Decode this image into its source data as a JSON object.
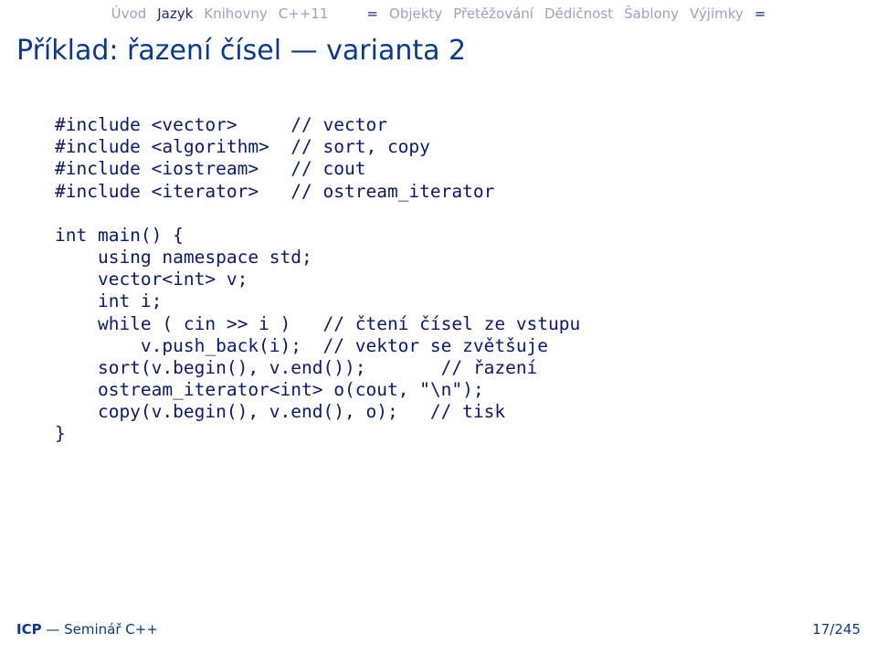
{
  "nav": {
    "items": [
      {
        "label": "Úvod",
        "active": false
      },
      {
        "label": "Jazyk",
        "active": true
      },
      {
        "label": "Knihovny",
        "active": false
      },
      {
        "label": "C++11",
        "active": false
      }
    ],
    "sep1": "=",
    "items2": [
      {
        "label": "Objekty",
        "active": false
      },
      {
        "label": "Přetěžování",
        "active": false
      },
      {
        "label": "Dědičnost",
        "active": false
      },
      {
        "label": "Šablony",
        "active": false
      },
      {
        "label": "Výjimky",
        "active": false
      }
    ],
    "sep2": "="
  },
  "title": "Příklad: řazení čísel — varianta 2",
  "code": "#include <vector>     // vector\n#include <algorithm>  // sort, copy\n#include <iostream>   // cout\n#include <iterator>   // ostream_iterator\n\nint main() {\n    using namespace std;\n    vector<int> v;\n    int i;\n    while ( cin >> i )   // čtení čísel ze vstupu\n        v.push_back(i);  // vektor se zvětšuje\n    sort(v.begin(), v.end());       // řazení\n    ostream_iterator<int> o(cout, \"\\n\");\n    copy(v.begin(), v.end(), o);   // tisk\n}",
  "footer": {
    "left_bold": "ICP",
    "left_rest": " — Seminář C++",
    "right": "17/245"
  }
}
